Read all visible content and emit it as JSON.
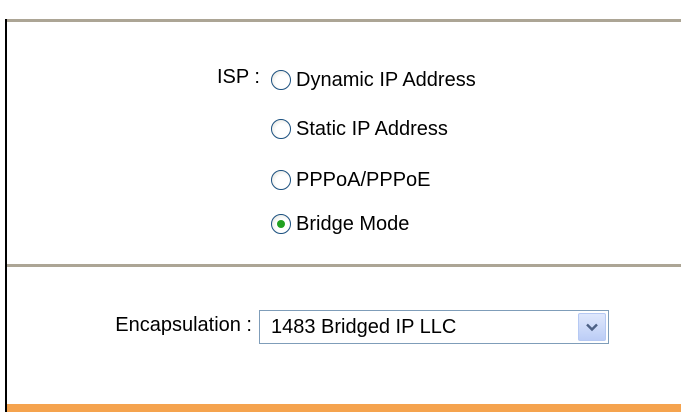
{
  "isp": {
    "label": "ISP :",
    "options": [
      {
        "label": "Dynamic IP Address",
        "checked": false
      },
      {
        "label": "Static IP Address",
        "checked": false
      },
      {
        "label": "PPPoA/PPPoE",
        "checked": false
      },
      {
        "label": "Bridge Mode",
        "checked": true
      }
    ]
  },
  "encapsulation": {
    "label": "Encapsulation :",
    "selected": "1483 Bridged IP LLC"
  },
  "colors": {
    "divider": "#aca595",
    "accent_bottom": "#f5a34e",
    "radio_selected_dot": "#21a121",
    "select_border": "#7f9db9"
  },
  "icons": {
    "dropdown_arrow": "chevron-down-icon"
  }
}
